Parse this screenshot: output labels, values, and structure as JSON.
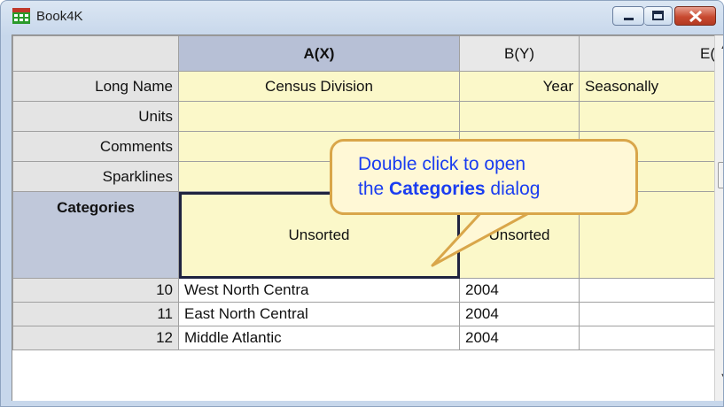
{
  "window": {
    "title": "Book4K"
  },
  "columns": [
    {
      "header": "A(X)",
      "long_name": "Census Division",
      "category": "Unsorted"
    },
    {
      "header": "B(Y)",
      "long_name": "Year",
      "category": "Unsorted"
    },
    {
      "header": "E(",
      "long_name": "Seasonally",
      "category": ""
    }
  ],
  "row_labels": {
    "long_name": "Long Name",
    "units": "Units",
    "comments": "Comments",
    "sparklines": "Sparklines",
    "categories": "Categories"
  },
  "rows": [
    {
      "num": "10",
      "a": "West North Centra",
      "b": "2004"
    },
    {
      "num": "11",
      "a": "East North Central",
      "b": "2004"
    },
    {
      "num": "12",
      "a": "Middle Atlantic",
      "b": "2004"
    }
  ],
  "callout": {
    "line1": "Double click to open",
    "line2_prefix": "the ",
    "line2_bold": "Categories",
    "line2_suffix": " dialog"
  }
}
